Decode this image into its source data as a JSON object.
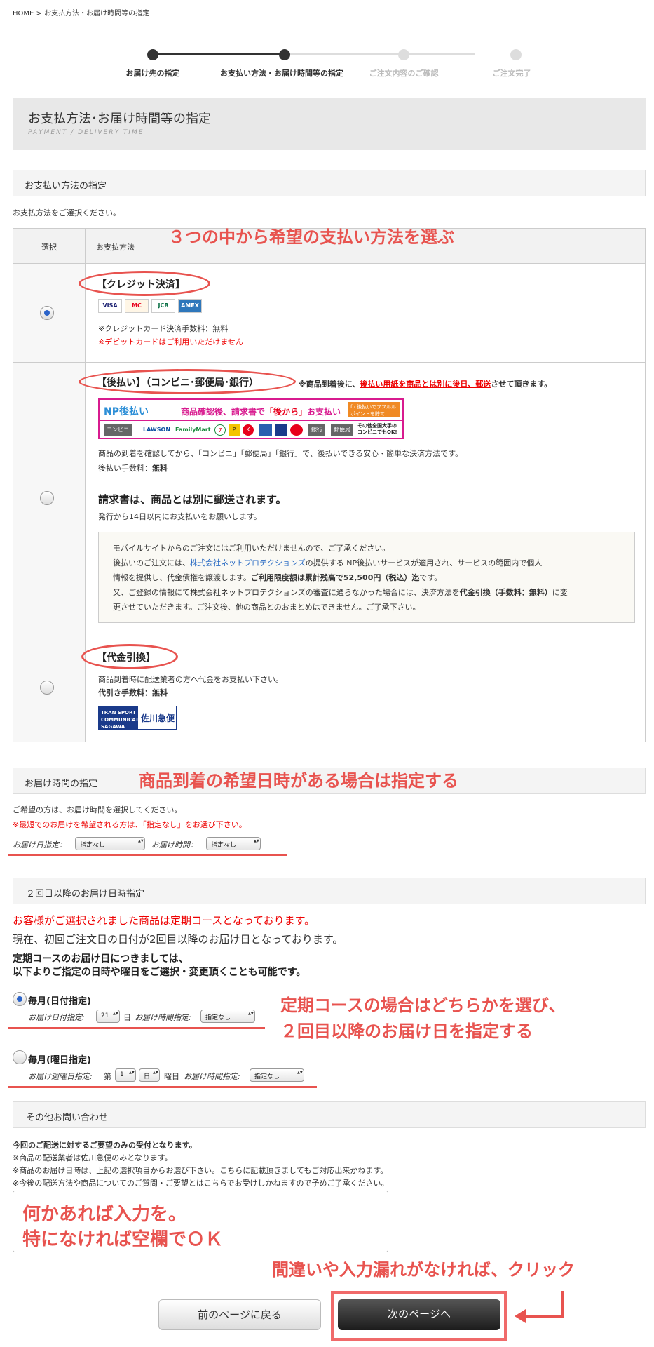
{
  "breadcrumb": {
    "home": "HOME",
    "sep": ">",
    "current": "お支払方法・お届け時間等の指定"
  },
  "steps": [
    {
      "label": "お届け先の指定",
      "state": "done"
    },
    {
      "label": "お支払い方法・お届け時間等の指定",
      "state": "current"
    },
    {
      "label": "ご注文内容のご確認",
      "state": "todo"
    },
    {
      "label": "ご注文完了",
      "state": "todo"
    }
  ],
  "page": {
    "title": "お支払方法･お届け時間等の指定",
    "subtitle": "PAYMENT / DELIVERY TIME"
  },
  "payment": {
    "section_title": "お支払い方法の指定",
    "intro": "お支払方法をご選択ください。",
    "col_select": "選択",
    "col_method": "お支払方法",
    "annotation": "３つの中から希望の支払い方法を選ぶ",
    "options": {
      "credit": {
        "title": "【クレジット決済】",
        "cards": [
          "VISA",
          "MC",
          "JCB",
          "AMEX"
        ],
        "fee": "※クレジットカード決済手数料：無料",
        "note": "※デビットカードはご利用いただけません",
        "selected": true
      },
      "np": {
        "title": "【後払い】（コンビニ･郵便局･銀行）",
        "note_pre": "※商品到着後に、",
        "note_red": "後払い用紙を商品とは別に後日、郵送",
        "note_post": "させて頂きます。",
        "banner": {
          "logo": "NP後払い",
          "msg_a": "商品確認後、請求書で",
          "msg_b": "「後から」",
          "msg_c": "お支払い",
          "fu": "fu 後払いでフフルル ポイントを貯て!",
          "tags": [
            "コンビニ",
            "LAWSON",
            "FamilyMart",
            "7",
            "P",
            "K",
            "銀行",
            "郵便局",
            "その他全国大手のコンビニでもOK!"
          ]
        },
        "desc": "商品の到着を確認してから、「コンビニ」「郵便局」「銀行」で、後払いできる安心・簡単な決済方法です。",
        "fee_label": "後払い手数料：",
        "fee_value": "無料",
        "invoice_heading": "請求書は、商品とは別に郵送されます。",
        "invoice_sub": "発行から14日以内にお支払いをお願いします。",
        "info": {
          "l1": "モバイルサイトからのご注文にはご利用いただけませんので、ご了承ください。",
          "l2_a": "後払いのご注文には、",
          "l2_link": "株式会社ネットプロテクションズ",
          "l2_b": "の提供する NP後払いサービスが適用され、サービスの範囲内で個人",
          "l3_a": "情報を提供し、代金債権を譲渡します。",
          "l3_b": "ご利用限度額は累計残高で52,500円（税込）迄",
          "l3_c": "です。",
          "l4_a": "又、ご登録の情報にて株式会社ネットプロテクションズの審査に通らなかった場合には、決済方法を",
          "l4_b": "代金引換（手数料：無料）",
          "l4_c": "に変",
          "l5": "更させていただきます。ご注文後、他の商品とのおまとめはできません。ご了承下さい。"
        },
        "selected": false
      },
      "cod": {
        "title": "【代金引換】",
        "desc": "商品到着時に配送業者の方へ代金をお支払い下さい。",
        "fee": "代引き手数料：無料",
        "logo_a": "TRAN SPORT COMMUNICATIONS SAGAWA",
        "logo_b": "佐川急便",
        "selected": false
      }
    }
  },
  "delivery": {
    "section_title": "お届け時間の指定",
    "annotation": "商品到着の希望日時がある場合は指定する",
    "line1": "ご希望の方は、お届け時間を選択してください。",
    "line2": "※最短でのお届けを希望される方は、「指定なし」をお選び下さい。",
    "date_label": "お届け日指定：",
    "date_value": "指定なし",
    "time_label": "お届け時間：",
    "time_value": "指定なし"
  },
  "recurring": {
    "section_title": "２回目以降のお届け日時指定",
    "red_line": "お客様がご選択されました商品は定期コースとなっております。",
    "line2": "現在、初回ご注文日の日付が2回目以降のお届け日となっております。",
    "bold1": "定期コースのお届け日につきましては、",
    "bold2": "以下よりご指定の日時や曜日をご選択・変更頂くことも可能です。",
    "annotation1": "定期コースの場合はどちらかを選び、",
    "annotation2": "２回目以降のお届け日を指定する",
    "opt1": {
      "title": "毎月(日付指定)",
      "date_label": "お届け日付指定:",
      "date_value": "21",
      "day_suffix": "日",
      "time_label": "お届け時間指定:",
      "time_value": "指定なし",
      "selected": true
    },
    "opt2": {
      "title": "毎月(曜日指定)",
      "week_label": "お届け週曜日指定:",
      "week_prefix": "第",
      "week_value": "1",
      "weekday_value": "日",
      "weekday_suffix": "曜日",
      "time_label": "お届け時間指定:",
      "time_value": "指定なし",
      "selected": false
    }
  },
  "inquiry": {
    "section_title": "その他お問い合わせ",
    "bold": "今回のご配送に対するご要望のみの受付となります。",
    "l1": "※商品の配送業者は佐川急便のみとなります。",
    "l2": "※商品のお届け日時は、上記の選択項目からお選び下さい。こちらに記載頂きましてもご対応出来かねます。",
    "l3": "※今後の配送方法や商品についてのご質問・ご要望とはこちらでお受けしかねますので予めご了承ください。",
    "textarea_annot1": "何かあれば入力を。",
    "textarea_annot2": "特になければ空欄でＯＫ"
  },
  "footer": {
    "annotation": "間違いや入力漏れがなければ、クリック",
    "prev_label": "前のページに戻る",
    "next_label": "次のページへ"
  },
  "colors": {
    "accent": "#e8534f",
    "pink": "#d81b8f",
    "nextbtn": "#222222"
  }
}
